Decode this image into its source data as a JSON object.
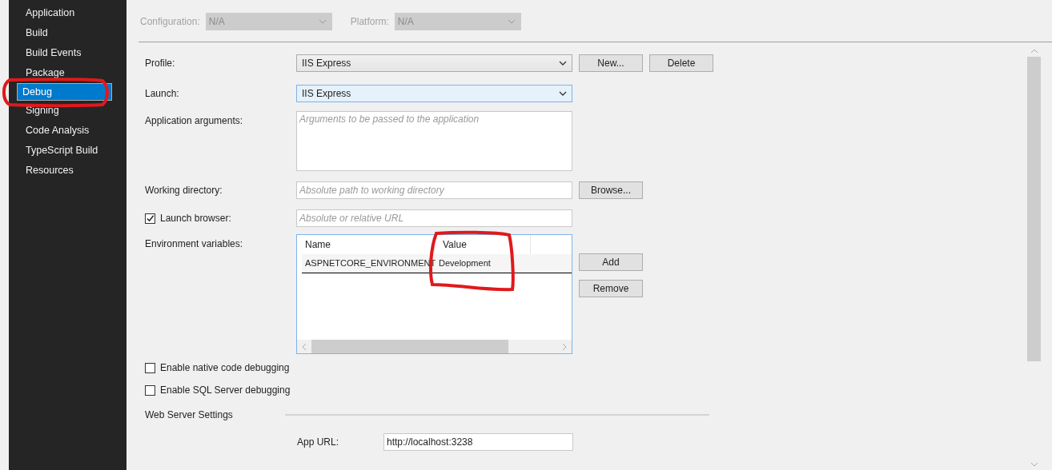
{
  "sidebar": {
    "items": [
      {
        "label": "Application",
        "selected": false
      },
      {
        "label": "Build",
        "selected": false
      },
      {
        "label": "Build Events",
        "selected": false
      },
      {
        "label": "Package",
        "selected": false
      },
      {
        "label": "Debug",
        "selected": true
      },
      {
        "label": "Signing",
        "selected": false
      },
      {
        "label": "Code Analysis",
        "selected": false
      },
      {
        "label": "TypeScript Build",
        "selected": false
      },
      {
        "label": "Resources",
        "selected": false
      }
    ]
  },
  "config": {
    "disabled": true,
    "configuration_label": "Configuration:",
    "configuration_value": "N/A",
    "platform_label": "Platform:",
    "platform_value": "N/A"
  },
  "profile": {
    "label": "Profile:",
    "value": "IIS Express",
    "buttons": [
      "New...",
      "Delete"
    ]
  },
  "launch": {
    "label": "Launch:",
    "value": "IIS Express",
    "focused": true
  },
  "app_arguments": {
    "label": "Application arguments:",
    "placeholder": "Arguments to be passed to the application"
  },
  "working_directory": {
    "label": "Working directory:",
    "placeholder": "Absolute path to working directory",
    "button": "Browse..."
  },
  "launch_browser": {
    "label": "Launch browser:",
    "checked": true,
    "placeholder": "Absolute or relative URL"
  },
  "environment_variables": {
    "label": "Environment variables:",
    "columns": [
      "Name",
      "Value"
    ],
    "rows": [
      {
        "name": "ASPNETCORE_ENVIRONMENT",
        "value": "Development"
      }
    ],
    "buttons": [
      "Add",
      "Remove"
    ]
  },
  "options": [
    {
      "label": "Enable native code debugging",
      "checked": false
    },
    {
      "label": "Enable SQL Server debugging",
      "checked": false
    }
  ],
  "web_server": {
    "title": "Web Server Settings",
    "app_url_label": "App URL:",
    "app_url": "http://localhost:3238"
  }
}
